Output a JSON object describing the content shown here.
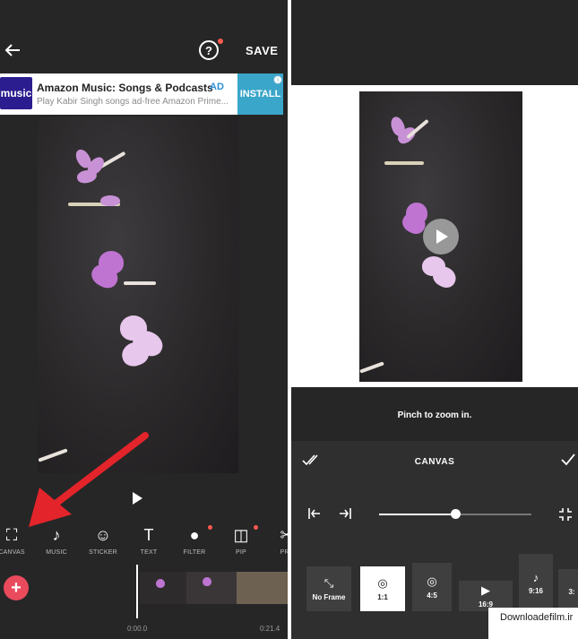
{
  "left": {
    "save_label": "SAVE",
    "help_glyph": "?",
    "ad": {
      "logo_text": "music",
      "title": "Amazon Music: Songs & Podcasts",
      "badge": "AD",
      "subtitle": "Play Kabir Singh songs ad-free Amazon Prime...",
      "install_label": "INSTALL",
      "info_glyph": "i"
    },
    "tools": [
      {
        "label": "CANVAS",
        "icon": "canvas-icon",
        "glyph": "⛶"
      },
      {
        "label": "MUSIC",
        "icon": "music-note-icon",
        "glyph": "♪"
      },
      {
        "label": "STICKER",
        "icon": "smiley-icon",
        "glyph": "☺"
      },
      {
        "label": "TEXT",
        "icon": "text-icon",
        "glyph": "T"
      },
      {
        "label": "FILTER",
        "icon": "filter-icon",
        "glyph": "●"
      },
      {
        "label": "PIP",
        "icon": "pip-icon",
        "glyph": "◫"
      },
      {
        "label": "PRE",
        "icon": "scissors-icon",
        "glyph": "✂"
      }
    ],
    "add_glyph": "+",
    "time_start": "0:00.0",
    "time_end": "0:21.4"
  },
  "right": {
    "hint": "Pinch to zoom in.",
    "canvas_title": "CANVAS",
    "slider_value": 0.5,
    "frames": [
      {
        "label": "No Frame",
        "icon": "collapse-icon",
        "glyph": "⤡",
        "selected": false
      },
      {
        "label": "1:1",
        "icon": "instagram-icon",
        "glyph": "◎",
        "selected": true
      },
      {
        "label": "4:5",
        "icon": "instagram-icon",
        "glyph": "◎",
        "selected": false
      },
      {
        "label": "16:9",
        "icon": "youtube-icon",
        "glyph": "▶",
        "selected": false
      },
      {
        "label": "9:16",
        "icon": "tiktok-icon",
        "glyph": "♪",
        "selected": false
      },
      {
        "label": "3:",
        "icon": "frame-icon",
        "glyph": "",
        "selected": false
      }
    ],
    "watermark": "Downloadefilm.ir"
  },
  "colors": {
    "accent_red": "#e94a5c",
    "arrow_red": "#e3242b",
    "panel_bg": "#262626",
    "ad_install": "#3aa6c9"
  }
}
